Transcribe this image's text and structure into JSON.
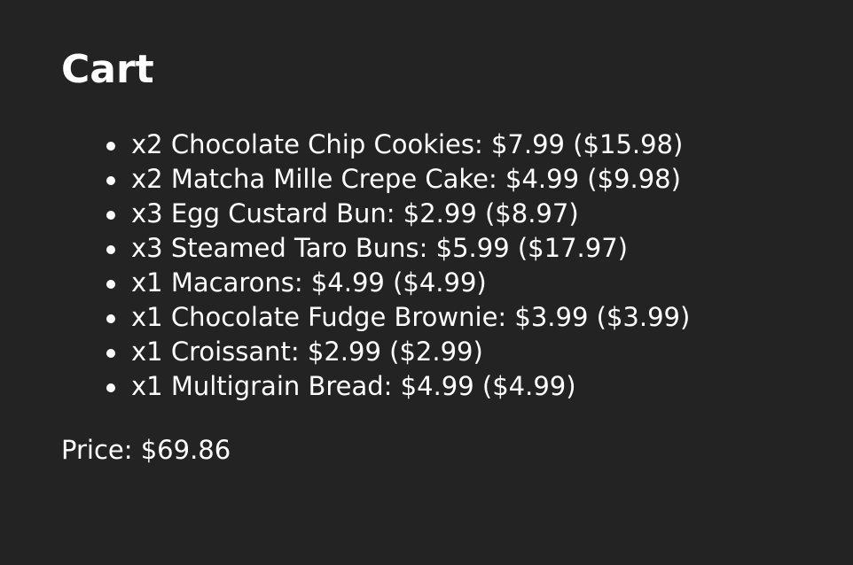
{
  "cart": {
    "title": "Cart",
    "items": [
      "x2 Chocolate Chip Cookies: $7.99 ($15.98)",
      "x2 Matcha Mille Crepe Cake: $4.99 ($9.98)",
      "x3 Egg Custard Bun: $2.99 ($8.97)",
      "x3 Steamed Taro Buns: $5.99 ($17.97)",
      "x1 Macarons: $4.99 ($4.99)",
      "x1 Chocolate Fudge Brownie: $3.99 ($3.99)",
      "x1 Croissant: $2.99 ($2.99)",
      "x1 Multigrain Bread: $4.99 ($4.99)"
    ],
    "price_text": "Price: $69.86"
  },
  "colors": {
    "background": "#232323",
    "text": "#ffffff"
  }
}
